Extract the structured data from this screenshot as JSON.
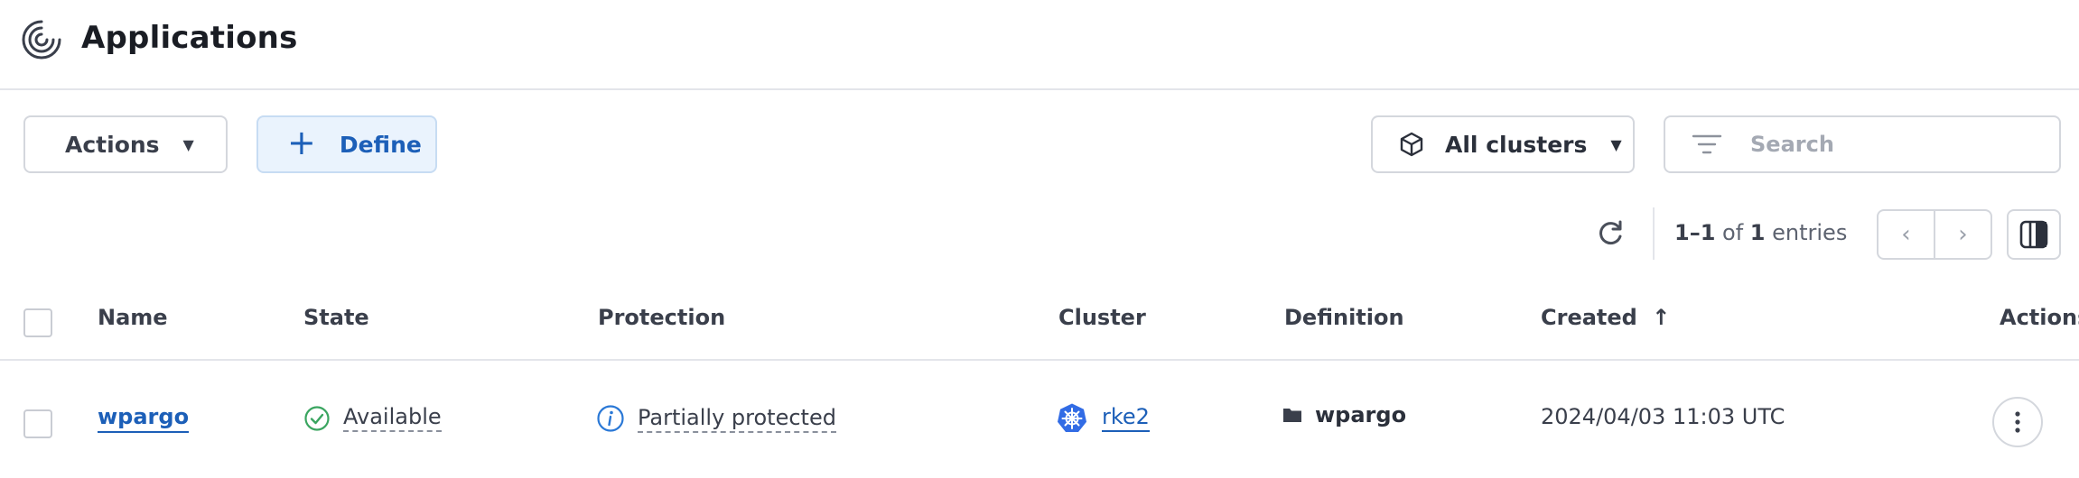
{
  "header": {
    "title": "Applications",
    "logo_icon": "concentric-rings-icon"
  },
  "toolbar": {
    "actions_label": "Actions",
    "define_label": "Define",
    "clusters_label": "All clusters",
    "search_placeholder": "Search"
  },
  "pagination": {
    "range": "1–1",
    "of_text": " of ",
    "total": "1",
    "entries_text": " entries"
  },
  "table": {
    "columns": {
      "name": "Name",
      "state": "State",
      "protection": "Protection",
      "cluster": "Cluster",
      "definition": "Definition",
      "created": "Created",
      "created_sort": "↑",
      "actions": "Actions"
    },
    "rows": [
      {
        "name": "wpargo",
        "state": "Available",
        "protection": "Partially protected",
        "cluster": "rke2",
        "definition": "wpargo",
        "created": "2024/04/03 11:03 UTC"
      }
    ]
  },
  "colors": {
    "accent": "#1c5fb8",
    "success": "#3aa560",
    "info": "#2a78d6",
    "kubernetes": "#326ce5"
  }
}
